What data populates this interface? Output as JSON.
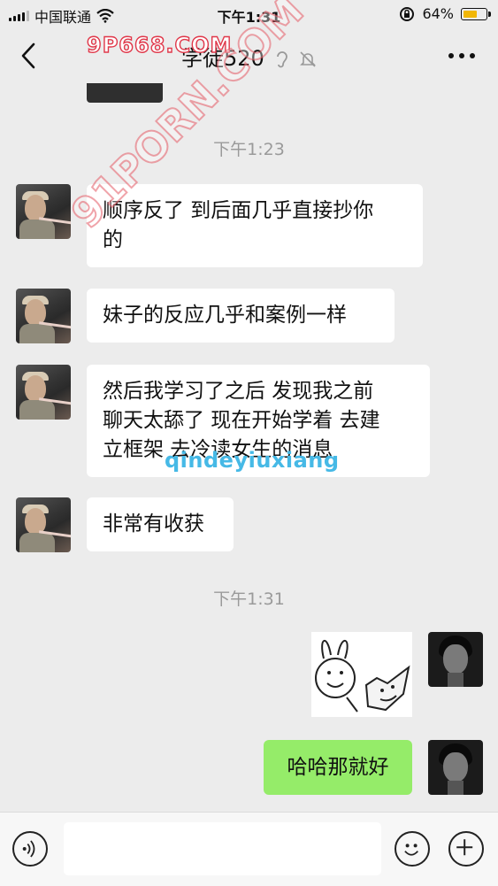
{
  "status_bar": {
    "carrier": "中国联通",
    "time": "下午1:31",
    "battery_text": "64%",
    "battery_level": 0.64,
    "battery_color": "#f2b705"
  },
  "header": {
    "title": "学徒520",
    "back_icon": "chevron-left-icon",
    "ear_icon": "ear-icon",
    "mute_icon": "bell-off-icon",
    "more_icon": "more-horizontal-icon"
  },
  "chat": {
    "timestamps": [
      "下午1:23",
      "下午1:31"
    ],
    "incoming": [
      {
        "lines": [
          "顺序反了 到后面几乎直接抄你",
          "的"
        ]
      },
      {
        "lines": [
          "妹子的反应几乎和案例一样"
        ]
      },
      {
        "lines": [
          "然后我学习了之后 发现我之前",
          "聊天太舔了 现在开始学着 去建",
          "立框架 去冷读女生的消息"
        ]
      },
      {
        "lines": [
          "非常有收获"
        ]
      }
    ],
    "outgoing": [
      {
        "type": "sticker"
      },
      {
        "text": "哈哈那就好"
      }
    ],
    "outgoing_bubble_color": "#95ec69"
  },
  "watermarks": [
    "9P668.COM",
    "91PORN.COM",
    "qindeyiuxiang"
  ],
  "input_bar": {
    "voice_icon": "voice-icon",
    "emoji_icon": "emoji-icon",
    "plus_icon": "plus-icon"
  }
}
